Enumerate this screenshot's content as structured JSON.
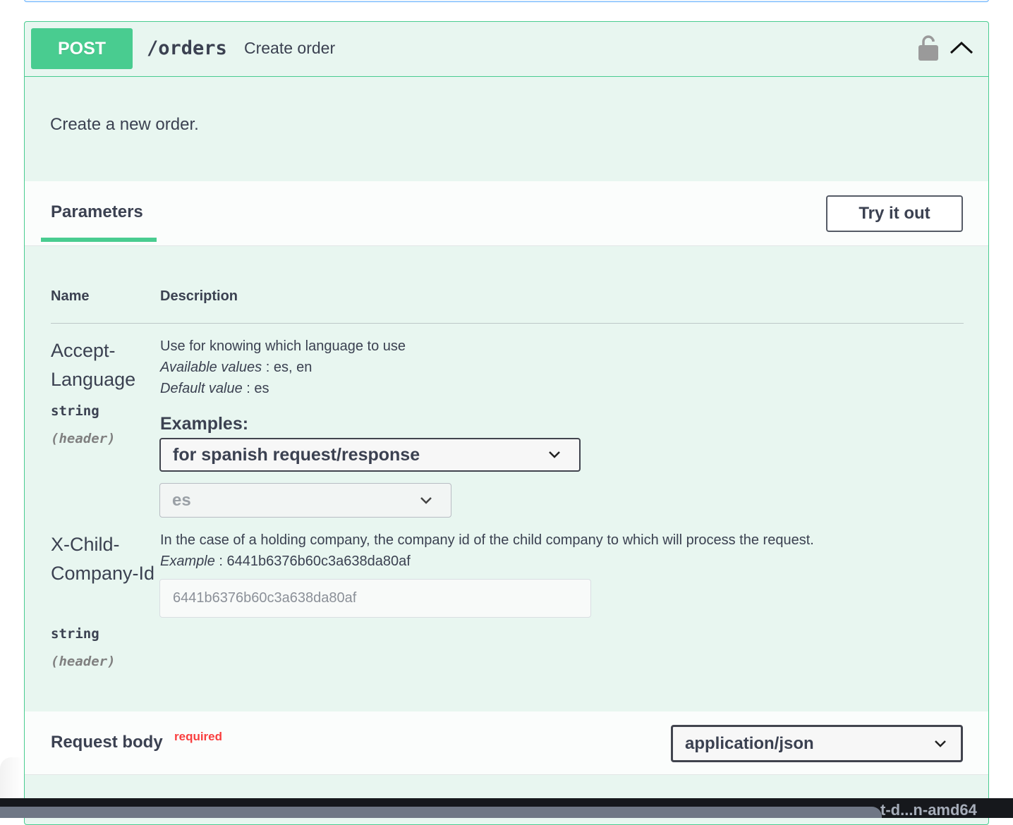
{
  "operation": {
    "method": "POST",
    "path": "/orders",
    "summary": "Create order",
    "description": "Create a new order."
  },
  "parameters_section": {
    "tab_label": "Parameters",
    "try_button": "Try it out",
    "columns": {
      "name": "Name",
      "description": "Description"
    }
  },
  "params": [
    {
      "name": "Accept-Language",
      "type": "string",
      "in": "(header)",
      "description": "Use for knowing which language to use",
      "available_label": "Available values",
      "available_values": "es, en",
      "default_label": "Default value",
      "default_value": "es",
      "examples_label": "Examples:",
      "examples_selected": "for spanish request/response",
      "value_selected": "es"
    },
    {
      "name": "X-Child-Company-Id",
      "type": "string",
      "in": "(header)",
      "description": "In the case of a holding company, the company id of the child company to which will process the request.",
      "example_label": "Example",
      "example_value": "6441b6376b60c3a638da80af",
      "placeholder": "6441b6376b60c3a638da80af"
    }
  ],
  "request_body": {
    "title": "Request body",
    "required": "required",
    "content_type": "application/json"
  },
  "taskbar": {
    "text": "t-d...n-amd64"
  },
  "colors": {
    "post": "#49cc90",
    "background": "#e8f6f0",
    "required": "#f93e3e"
  },
  "icons": [
    "lock-icon",
    "chevron-up-icon",
    "chevron-down-icon"
  ]
}
